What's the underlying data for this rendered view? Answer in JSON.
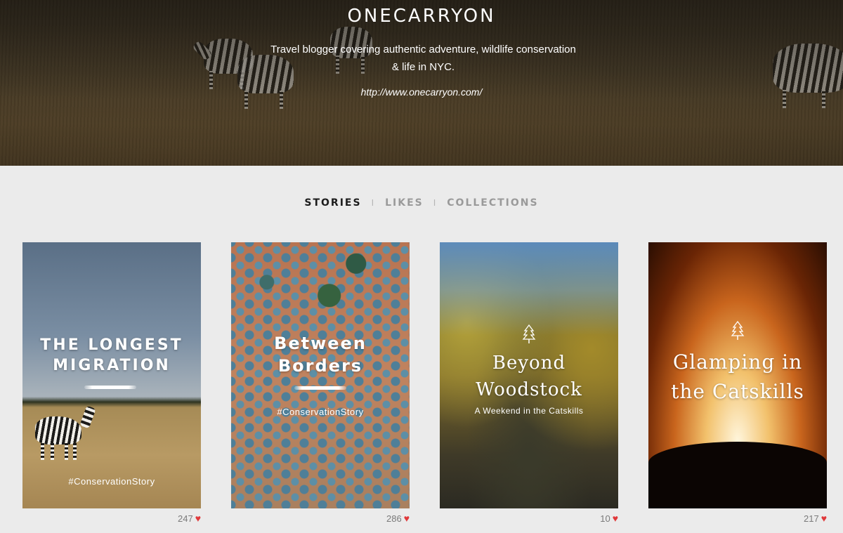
{
  "profile": {
    "title": "ONECARRYON",
    "bio": "Travel blogger covering authentic adventure, wildlife conservation & life in NYC.",
    "url": "http://www.onecarryon.com/"
  },
  "tabs": [
    {
      "label": "STORIES",
      "active": true
    },
    {
      "label": "LIKES",
      "active": false
    },
    {
      "label": "COLLECTIONS",
      "active": false
    }
  ],
  "tab_separator": "I",
  "stories": [
    {
      "title_line1": "THE LONGEST",
      "title_line2": "MIGRATION",
      "tag": "#ConservationStory",
      "likes": "247"
    },
    {
      "title_line1": "Between",
      "title_line2": "Borders",
      "tag": "#ConservationStory",
      "likes": "286"
    },
    {
      "title_line1": "Beyond",
      "title_line2": "Woodstock",
      "tag": "A Weekend in the Catskills",
      "likes": "10"
    },
    {
      "title_line1": "Glamping in",
      "title_line2": "the Catskills",
      "tag": "",
      "likes": "217"
    }
  ],
  "colors": {
    "background": "#ebebeb",
    "tab_active": "#1c1c1c",
    "tab_inactive": "#9a9a9a",
    "heart": "#e0383a"
  },
  "icons": [
    "heart-icon",
    "tree-icon"
  ]
}
